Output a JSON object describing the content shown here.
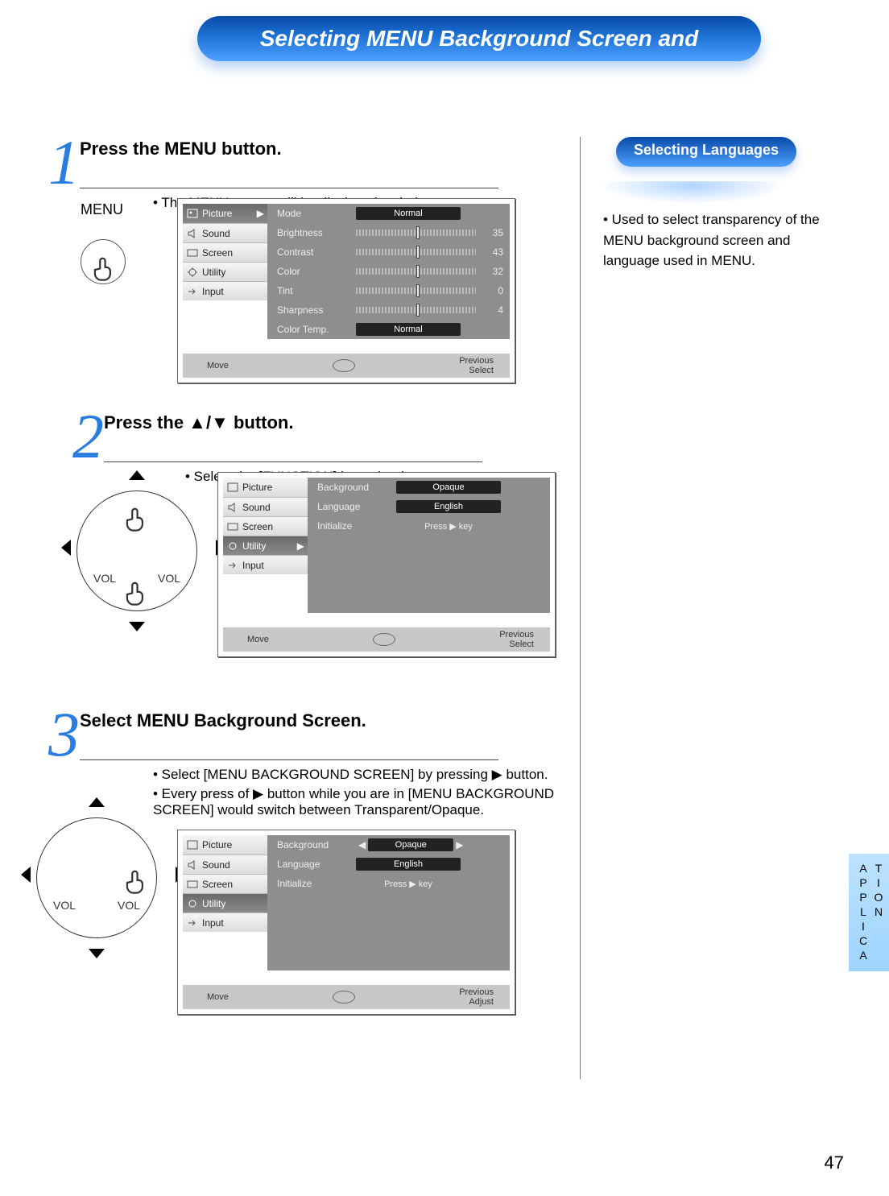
{
  "page_title": "Selecting MENU Background Screen and Languages",
  "page_number": "47",
  "side_tab": {
    "col1": "APPLICA",
    "col2": "TION"
  },
  "step1": {
    "num": "1",
    "title": "Press the MENU button.",
    "sub": "• The MENU screen will be displayed as below.",
    "button_label": "MENU",
    "menu": {
      "sidebar": [
        "Picture",
        "Sound",
        "Screen",
        "Utility",
        "Input"
      ],
      "active_index": 0,
      "rows": [
        {
          "label": "Mode",
          "value_box": "Normal"
        },
        {
          "label": "Brightness",
          "value_num": "35"
        },
        {
          "label": "Contrast",
          "value_num": "43"
        },
        {
          "label": "Color",
          "value_num": "32"
        },
        {
          "label": "Tint",
          "value_num": "0"
        },
        {
          "label": "Sharpness",
          "value_num": "4"
        },
        {
          "label": "Color Temp.",
          "value_box": "Normal"
        }
      ],
      "hint_move": "Move",
      "hint_prev": "Previous",
      "hint_sel": "Select"
    }
  },
  "step2": {
    "num": "2",
    "title": "Press the ▲/▼ button.",
    "sub": "• Select the [FUNCTION] by  ▲ / ▼  button.",
    "vol_label": "VOL",
    "menu": {
      "sidebar": [
        "Picture",
        "Sound",
        "Screen",
        "Utility",
        "Input"
      ],
      "active_index": 3,
      "rows": [
        {
          "label": "Background",
          "value_box": "Opaque"
        },
        {
          "label": "Language",
          "value_box": "English"
        },
        {
          "label": "Initialize",
          "value_text": "Press ▶ key"
        }
      ],
      "hint_move": "Move",
      "hint_prev": "Previous",
      "hint_sel": "Select"
    }
  },
  "step3": {
    "num": "3",
    "title": "Select MENU Background Screen.",
    "sub1": "• Select [MENU BACKGROUND SCREEN] by pressing ▶ button.",
    "sub2": "• Every press of ▶ button while you are in [MENU BACKGROUND SCREEN] would switch between Transparent/Opaque.",
    "vol_label": "VOL",
    "menu": {
      "sidebar": [
        "Picture",
        "Sound",
        "Screen",
        "Utility",
        "Input"
      ],
      "active_index": 3,
      "rows": [
        {
          "label": "Background",
          "value_box": "Opaque",
          "arrows": true
        },
        {
          "label": "Language",
          "value_box": "English"
        },
        {
          "label": "Initialize",
          "value_text": "Press ▶ key"
        }
      ],
      "hint_move": "Move",
      "hint_prev": "Previous",
      "hint_sel": "Adjust"
    }
  },
  "rcol": {
    "title": "Selecting Languages",
    "text": "• Used to select transparency of the MENU background screen and language used in MENU."
  }
}
